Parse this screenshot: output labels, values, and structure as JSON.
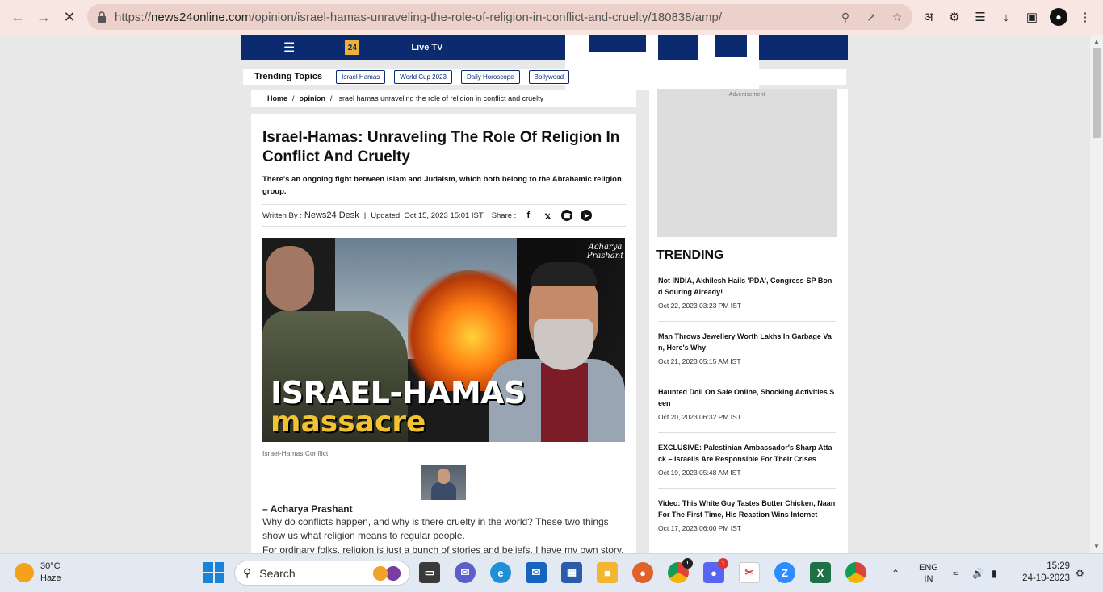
{
  "browser": {
    "url_prefix": "https://",
    "url_host": "news24online.com",
    "url_path": "/opinion/israel-hamas-unraveling-the-role-of-religion-in-conflict-and-cruelty/180838/amp/",
    "ext_hindi_glyph": "अ"
  },
  "site": {
    "live_tv": "Live TV",
    "logo_text": "24",
    "trending_label": "Trending Topics",
    "trending_topics": [
      "Israel Hamas",
      "World Cup 2023",
      "Daily Horoscope",
      "Bollywood"
    ]
  },
  "breadcrumb": {
    "home": "Home",
    "section": "opinion",
    "current": "israel hamas unraveling the role of religion in conflict and cruelty",
    "separator": "/"
  },
  "article": {
    "headline": "Israel-Hamas: Unraveling The Role Of Religion In Conflict And Cruelty",
    "summary": "There's an ongoing fight between Islam and Judaism, which both belong to the Abrahamic religion group.",
    "written_by_label": "Written By :",
    "author": "News24 Desk",
    "updated": "Updated: Oct 15, 2023 15:01 IST",
    "share_label": "Share :",
    "hero_title_line1": "ISRAEL-HAMAS",
    "hero_title_line2": "massacre",
    "hero_signature": "Acharya Prashant",
    "caption": "Israel-Hamas Conflict",
    "byline_name": "– Acharya Prashant",
    "paragraph1": "Why do conflicts happen, and why is there cruelty in the world? These two things show us what religion means to regular people.",
    "paragraph2": "For ordinary folks, religion is just a bunch of stories and beliefs. I have my own story,"
  },
  "sidebar": {
    "ad_label": "---Advertisement---",
    "trending_title": "TRENDING",
    "items": [
      {
        "title": "Not INDIA, Akhilesh Hails 'PDA', Congress-SP Bond Souring Already!",
        "date": "Oct 22, 2023 03:23 PM IST"
      },
      {
        "title": "Man Throws Jewellery Worth Lakhs In Garbage Van, Here's Why",
        "date": "Oct 21, 2023 05:15 AM IST"
      },
      {
        "title": "Haunted Doll On Sale Online, Shocking Activities Seen",
        "date": "Oct 20, 2023 06:32 PM IST"
      },
      {
        "title": "EXCLUSIVE: Palestinian Ambassador's Sharp Attack – Israelis Are Responsible For Their Crises",
        "date": "Oct 19, 2023 05:48 AM IST"
      },
      {
        "title": "Video: This White Guy Tastes Butter Chicken, Naan For The First Time, His Reaction Wins Internet",
        "date": "Oct 17, 2023 06:00 PM IST"
      }
    ]
  },
  "taskbar": {
    "temperature": "30°C",
    "weather": "Haze",
    "search_placeholder": "Search",
    "lang_top": "ENG",
    "lang_bottom": "IN",
    "time": "15:29",
    "date": "24-10-2023",
    "chrome_badge": "!",
    "discord_badge": "1"
  }
}
